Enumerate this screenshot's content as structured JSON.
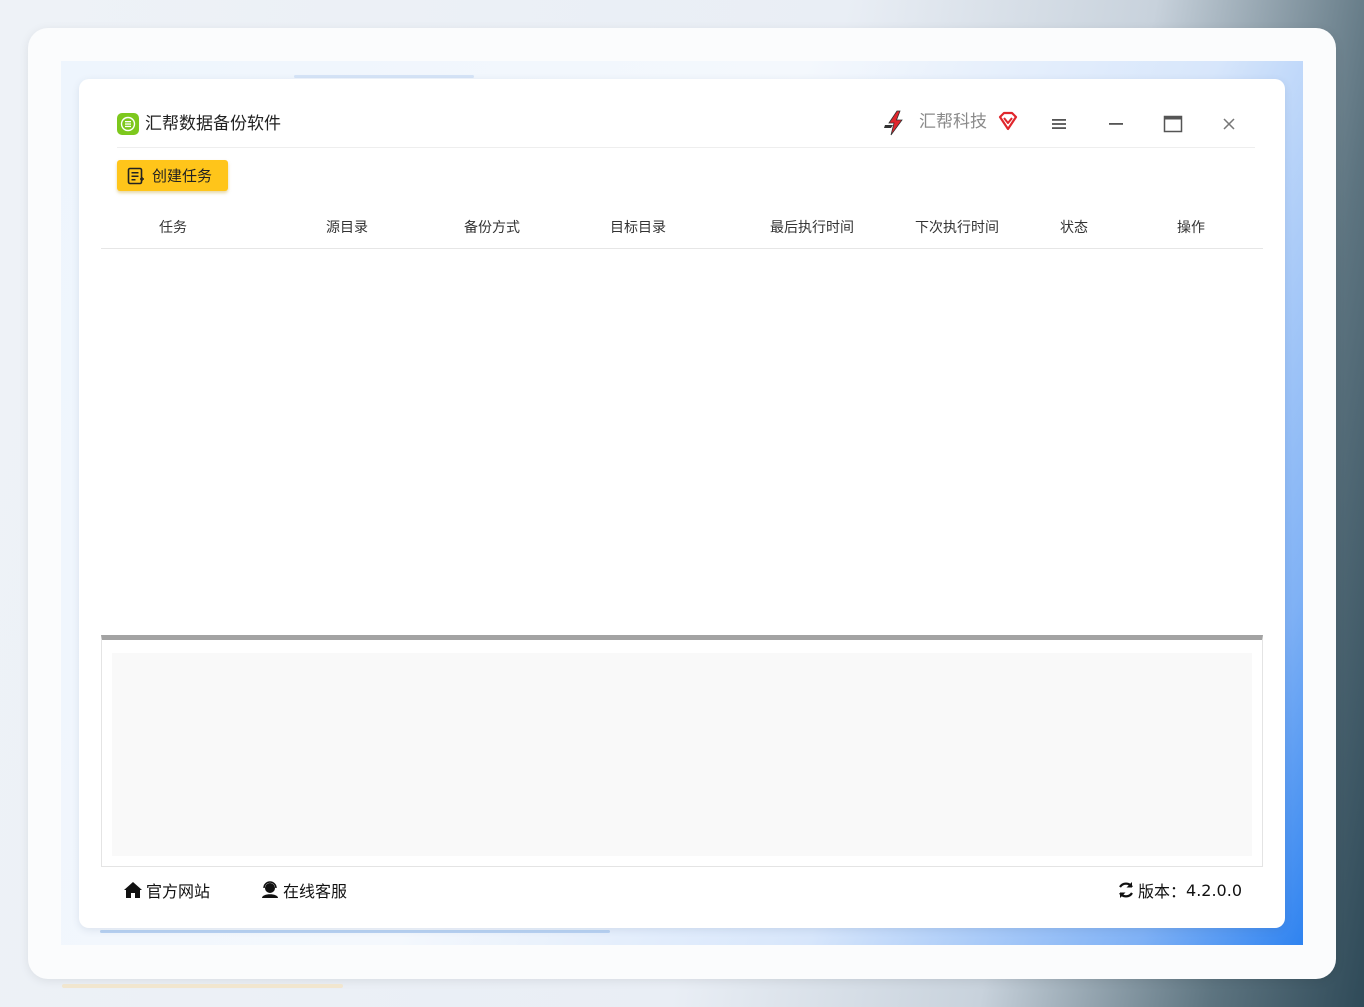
{
  "app": {
    "title": "汇帮数据备份软件",
    "brand": "汇帮科技"
  },
  "toolbar": {
    "create_task_label": "创建任务"
  },
  "table": {
    "columns": [
      "任务",
      "源目录",
      "备份方式",
      "目标目录",
      "最后执行时间",
      "下次执行时间",
      "状态",
      "操作"
    ],
    "rows": []
  },
  "footer": {
    "official_site_label": "官方网站",
    "online_service_label": "在线客服",
    "version_label": "版本：",
    "version_value": "4.2.0.0"
  },
  "colors": {
    "accent": "#ffc51a",
    "app_logo": "#7dc81d",
    "brand_red": "#e0262c"
  },
  "icons": {
    "app_logo": "app-logo-icon",
    "brand_logo": "brand-logo-icon",
    "vip": "vip-diamond-icon",
    "menu": "hamburger-menu-icon",
    "minimize": "minimize-icon",
    "maximize": "maximize-icon",
    "close": "close-icon",
    "create": "task-list-icon",
    "home": "home-icon",
    "service": "customer-service-icon",
    "refresh": "refresh-icon"
  }
}
